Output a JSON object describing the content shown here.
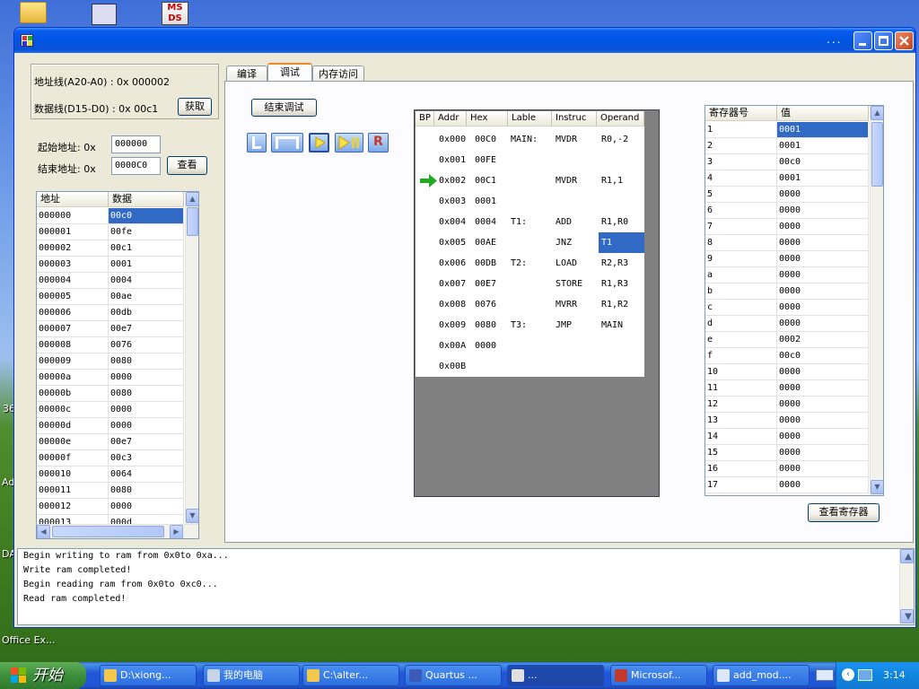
{
  "desktop": {
    "labels": [
      "36",
      "Ad",
      "DA",
      "Office Ex..."
    ]
  },
  "window": {
    "title_buttons": [
      "minimize",
      "maximize",
      "close"
    ]
  },
  "bus": {
    "addr_label": "地址线(A20-A0) : 0x 000002",
    "data_label": "数据线(D15-D0) : 0x 00c1",
    "fetch_button": "获取"
  },
  "range": {
    "start_label": "起始地址: 0x",
    "start_value": "000000",
    "end_label": "结束地址: 0x",
    "end_value": "0000C0",
    "view_button": "查看"
  },
  "memory": {
    "headers": [
      "地址",
      "数据"
    ],
    "selected_row": 0,
    "rows": [
      [
        "000000",
        "00c0"
      ],
      [
        "000001",
        "00fe"
      ],
      [
        "000002",
        "00c1"
      ],
      [
        "000003",
        "0001"
      ],
      [
        "000004",
        "0004"
      ],
      [
        "000005",
        "00ae"
      ],
      [
        "000006",
        "00db"
      ],
      [
        "000007",
        "00e7"
      ],
      [
        "000008",
        "0076"
      ],
      [
        "000009",
        "0080"
      ],
      [
        "00000a",
        "0000"
      ],
      [
        "00000b",
        "0080"
      ],
      [
        "00000c",
        "0000"
      ],
      [
        "00000d",
        "0000"
      ],
      [
        "00000e",
        "00e7"
      ],
      [
        "00000f",
        "00c3"
      ],
      [
        "000010",
        "0064"
      ],
      [
        "000011",
        "0080"
      ],
      [
        "000012",
        "0000"
      ],
      [
        "000013",
        "000d"
      ]
    ]
  },
  "tabs": [
    {
      "label": "编译",
      "active": false
    },
    {
      "label": "调试",
      "active": true
    },
    {
      "label": "内存访问",
      "active": false
    }
  ],
  "debug": {
    "end_button": "结束调试",
    "toolbar": [
      "step-icon",
      "step-over-icon",
      "run-icon",
      "run-pause-icon",
      "reset-icon"
    ]
  },
  "code": {
    "headers": [
      "BP",
      "Addr",
      "Hex",
      "Lable",
      "Instruc",
      "Operand"
    ],
    "current_row": 2,
    "selected_operand_row": 5,
    "rows": [
      {
        "addr": "0x000",
        "hex": "00C0",
        "label": "MAIN:",
        "instr": "MVDR",
        "operand": "R0,-2"
      },
      {
        "addr": "0x001",
        "hex": "00FE",
        "label": "",
        "instr": "",
        "operand": ""
      },
      {
        "addr": "0x002",
        "hex": "00C1",
        "label": "",
        "instr": "MVDR",
        "operand": "R1,1"
      },
      {
        "addr": "0x003",
        "hex": "0001",
        "label": "",
        "instr": "",
        "operand": ""
      },
      {
        "addr": "0x004",
        "hex": "0004",
        "label": "T1:",
        "instr": "ADD",
        "operand": "R1,R0"
      },
      {
        "addr": "0x005",
        "hex": "00AE",
        "label": "",
        "instr": "JNZ",
        "operand": "T1"
      },
      {
        "addr": "0x006",
        "hex": "00DB",
        "label": "T2:",
        "instr": "LOAD",
        "operand": "R2,R3"
      },
      {
        "addr": "0x007",
        "hex": "00E7",
        "label": "",
        "instr": "STORE",
        "operand": "R1,R3"
      },
      {
        "addr": "0x008",
        "hex": "0076",
        "label": "",
        "instr": "MVRR",
        "operand": "R1,R2"
      },
      {
        "addr": "0x009",
        "hex": "0080",
        "label": "T3:",
        "instr": "JMP",
        "operand": "MAIN"
      },
      {
        "addr": "0x00A",
        "hex": "0000",
        "label": "",
        "instr": "",
        "operand": ""
      },
      {
        "addr": "0x00B",
        "hex": "",
        "label": "",
        "instr": "",
        "operand": ""
      }
    ]
  },
  "registers": {
    "headers": [
      "寄存器号",
      "值"
    ],
    "selected_row": 0,
    "rows": [
      [
        "1",
        "0001"
      ],
      [
        "2",
        "0001"
      ],
      [
        "3",
        "00c0"
      ],
      [
        "4",
        "0001"
      ],
      [
        "5",
        "0000"
      ],
      [
        "6",
        "0000"
      ],
      [
        "7",
        "0000"
      ],
      [
        "8",
        "0000"
      ],
      [
        "9",
        "0000"
      ],
      [
        "a",
        "0000"
      ],
      [
        "b",
        "0000"
      ],
      [
        "c",
        "0000"
      ],
      [
        "d",
        "0000"
      ],
      [
        "e",
        "0002"
      ],
      [
        "f",
        "00c0"
      ],
      [
        "10",
        "0000"
      ],
      [
        "11",
        "0000"
      ],
      [
        "12",
        "0000"
      ],
      [
        "13",
        "0000"
      ],
      [
        "14",
        "0000"
      ],
      [
        "15",
        "0000"
      ],
      [
        "16",
        "0000"
      ],
      [
        "17",
        "0000"
      ]
    ],
    "view_button": "查看寄存器"
  },
  "log": [
    "Begin writing to ram from 0x0to 0xa...",
    "Write ram completed!",
    "Begin reading ram from 0x0to 0xc0...",
    "Read ram completed!"
  ],
  "taskbar": {
    "start": "开始",
    "tasks": [
      {
        "label": "D:\\xiong...",
        "icon": "folder-icon",
        "color": "#f2c94c"
      },
      {
        "label": "我的电脑",
        "icon": "computer-icon",
        "color": "#c8d4e8"
      },
      {
        "label": "C:\\alter...",
        "icon": "folder-icon",
        "color": "#f2c94c"
      },
      {
        "label": "Quartus ...",
        "icon": "quartus-icon",
        "color": "#3c5bb8"
      },
      {
        "label": "...",
        "icon": "app-icon",
        "color": "#e0e0e0",
        "active": true
      },
      {
        "label": "Microsof...",
        "icon": "office-icon",
        "color": "#c0392b"
      },
      {
        "label": "add_mod....",
        "icon": "document-icon",
        "color": "#dfe7f7"
      }
    ],
    "time": "3:14"
  },
  "colors": {
    "selection": "#316ac5",
    "arrow": "#22aa22",
    "titlebar": "#0054e3"
  }
}
